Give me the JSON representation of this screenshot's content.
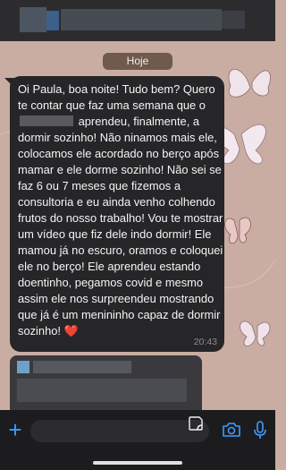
{
  "chat": {
    "date_separator": "Hoje",
    "message": {
      "text_before_redaction": "Oi Paula, boa noite! Tudo bem? Quero te contar que faz uma semana que o",
      "text_after_redaction": "aprendeu, finalmente, a dormir sozinho! Não ninamos mais ele, colocamos ele acordado no berço após mamar e ele dorme sozinho! Não sei se faz 6 ou 7 meses que fizemos a consultoria e eu ainda venho colhendo frutos do nosso trabalho! Vou te mostrar um vídeo que fiz dele indo dormir! Ele mamou já no escuro, oramos e coloquei ele no berço! Ele aprendeu estando doentinho, pegamos covid e mesmo assim ele nos surpreendeu mostrando que já é um menininho capaz de dormir sozinho!",
      "emoji": "❤️",
      "time": "20:43"
    }
  },
  "colors": {
    "wallpaper": "#c9ada2",
    "bubble": "#262628",
    "accent": "#3d9bff"
  },
  "icons": [
    "plus-icon",
    "sticker-icon",
    "camera-icon",
    "mic-icon",
    "butterfly-decoration"
  ]
}
